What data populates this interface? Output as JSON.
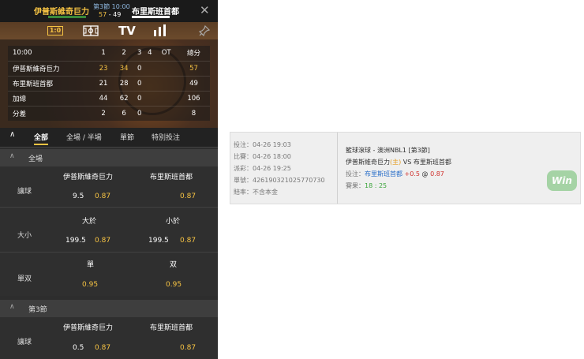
{
  "header": {
    "home_team": "伊普斯維奇巨力",
    "period": "第3節 10:00",
    "home_score": "57",
    "score_sep": "-",
    "away_score": "49",
    "away_team": "布里斯班首都"
  },
  "icons": {
    "score_label": "1:0",
    "tv_label": "TV"
  },
  "scoreboard": {
    "header": [
      "10:00",
      "1",
      "2",
      "3",
      "4",
      "OT",
      "總分"
    ],
    "rows": [
      {
        "name": "伊普斯維奇巨力",
        "q1": "23",
        "q2": "34",
        "q3": "0",
        "q4": "",
        "ot": "",
        "total": "57"
      },
      {
        "name": "布里斯班首都",
        "q1": "21",
        "q2": "28",
        "q3": "0",
        "q4": "",
        "ot": "",
        "total": "49"
      },
      {
        "name": "加總",
        "q1": "44",
        "q2": "62",
        "q3": "0",
        "q4": "",
        "ot": "",
        "total": "106"
      },
      {
        "name": "分差",
        "q1": "2",
        "q2": "6",
        "q3": "0",
        "q4": "",
        "ot": "",
        "total": "8"
      }
    ]
  },
  "tabs": [
    "全部",
    "全場 / 半場",
    "單節",
    "特別投注"
  ],
  "full_game": {
    "section_title": "全場",
    "handicap": {
      "label": "讓球",
      "home": "伊普斯維奇巨力",
      "away": "布里斯班首都",
      "home_line": "9.5",
      "home_odds": "0.87",
      "away_odds": "0.87"
    },
    "totals": {
      "label": "大小",
      "over": "大於",
      "under": "小於",
      "over_line": "199.5",
      "over_odds": "0.87",
      "under_line": "199.5",
      "under_odds": "0.87"
    },
    "odd_even": {
      "label": "單双",
      "odd": "單",
      "even": "双",
      "odd_odds": "0.95",
      "even_odds": "0.95"
    }
  },
  "quarter3": {
    "section_title": "第3節",
    "handicap": {
      "label": "讓球",
      "home": "伊普斯維奇巨力",
      "away": "布里斯班首都",
      "home_line": "0.5",
      "home_odds": "0.87",
      "away_odds": "0.87"
    }
  },
  "bet_slip": {
    "placed": "投注：04-26 19:03",
    "match_time": "比賽：04-26 18:00",
    "settled": "派彩：04-26 19:25",
    "ticket": "單號：4261903210257707​30",
    "risk": "賠率：不含本金",
    "title": "籃球滾球 - 澳洲NBL1 [第3節]",
    "home": "伊普斯維奇巨力",
    "home_tag": "(主)",
    "vs": "VS",
    "away": "布里斯班首都",
    "bet_label": "投注：",
    "bet_team": "布里斯班首都",
    "bet_line": "+0.5",
    "bet_at": "@",
    "bet_odds": "0.87",
    "result_label": "賽果：",
    "result": "18 : 25",
    "badge": "Win"
  },
  "colors": {
    "accent": "#f6c343",
    "blue": "#2a6fc9",
    "red": "#d0312d",
    "green": "#3aa43a"
  }
}
